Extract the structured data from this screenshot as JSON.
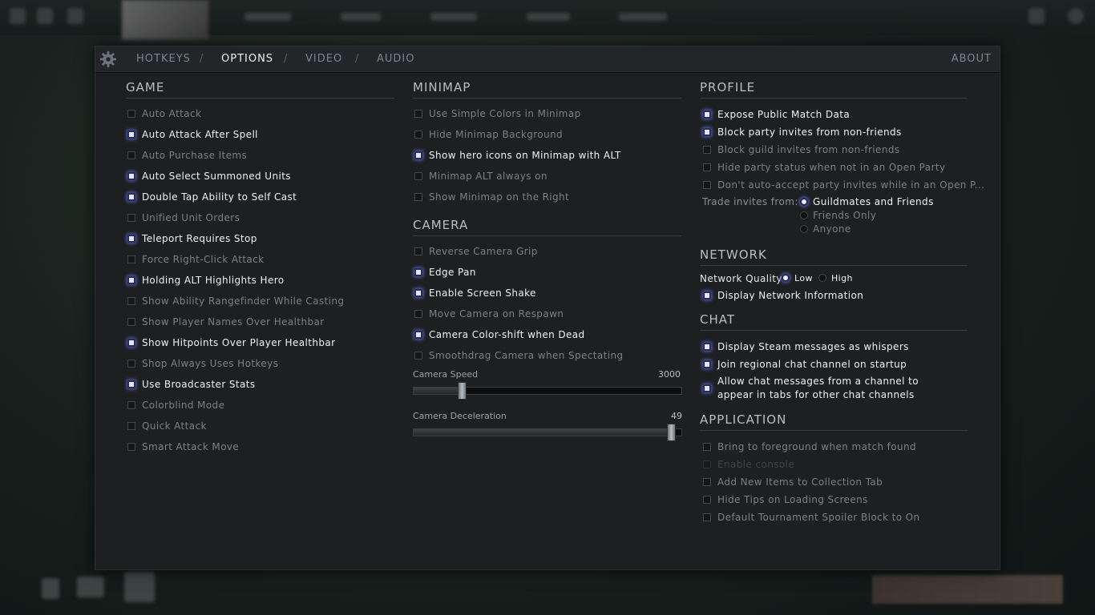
{
  "tabs": [
    "HOTKEYS",
    "OPTIONS",
    "VIDEO",
    "AUDIO"
  ],
  "tab_separator": "/",
  "about_label": "ABOUT",
  "game": {
    "title": "GAME",
    "options": [
      {
        "label": "Auto Attack",
        "checked": false
      },
      {
        "label": "Auto Attack After Spell",
        "checked": true
      },
      {
        "label": "Auto Purchase Items",
        "checked": false
      },
      {
        "label": "Auto Select Summoned Units",
        "checked": true
      },
      {
        "label": "Double Tap Ability to Self Cast",
        "checked": true
      },
      {
        "label": "Unified Unit Orders",
        "checked": false
      },
      {
        "label": "Teleport Requires Stop",
        "checked": true
      },
      {
        "label": "Force Right-Click Attack",
        "checked": false
      },
      {
        "label": "Holding ALT Highlights Hero",
        "checked": true
      },
      {
        "label": "Show Ability Rangefinder While Casting",
        "checked": false
      },
      {
        "label": "Show Player Names Over Healthbar",
        "checked": false
      },
      {
        "label": "Show Hitpoints Over Player Healthbar",
        "checked": true
      },
      {
        "label": "Shop Always Uses Hotkeys",
        "checked": false
      },
      {
        "label": "Use Broadcaster Stats",
        "checked": true
      },
      {
        "label": "Colorblind Mode",
        "checked": false
      },
      {
        "label": "Quick Attack",
        "checked": false
      },
      {
        "label": "Smart Attack Move",
        "checked": false
      }
    ]
  },
  "minimap": {
    "title": "MINIMAP",
    "options": [
      {
        "label": "Use Simple Colors in Minimap",
        "checked": false
      },
      {
        "label": "Hide Minimap Background",
        "checked": false
      },
      {
        "label": "Show hero icons on Minimap with ALT",
        "checked": true
      },
      {
        "label": "Minimap ALT always on",
        "checked": false
      },
      {
        "label": "Show Minimap on the Right",
        "checked": false
      }
    ]
  },
  "camera": {
    "title": "CAMERA",
    "options": [
      {
        "label": "Reverse Camera Grip",
        "checked": false
      },
      {
        "label": "Edge Pan",
        "checked": true
      },
      {
        "label": "Enable Screen Shake",
        "checked": true
      },
      {
        "label": "Move Camera on Respawn",
        "checked": false
      },
      {
        "label": "Camera Color-shift when Dead",
        "checked": true
      },
      {
        "label": "Smoothdrag Camera when Spectating",
        "checked": false
      }
    ],
    "speed_label": "Camera Speed",
    "speed_value": "3000",
    "speed_fraction": 0.18,
    "decel_label": "Camera Deceleration",
    "decel_value": "49",
    "decel_fraction": 0.96
  },
  "profile": {
    "title": "PROFILE",
    "options": [
      {
        "label": "Expose Public Match Data",
        "checked": true
      },
      {
        "label": "Block party invites from non-friends",
        "checked": true
      },
      {
        "label": "Block guild invites from non-friends",
        "checked": false
      },
      {
        "label": "Hide party status when not in an Open Party",
        "checked": false
      },
      {
        "label": "Don't auto-accept party invites while in an Open P...",
        "checked": false
      }
    ],
    "trade_label": "Trade invites from:",
    "trade_options": [
      {
        "label": "Guildmates and Friends",
        "selected": true
      },
      {
        "label": "Friends Only",
        "selected": false
      },
      {
        "label": "Anyone",
        "selected": false
      }
    ]
  },
  "network": {
    "title": "NETWORK",
    "quality_label": "Network Quality",
    "quality_options": [
      {
        "label": "Low",
        "selected": true
      },
      {
        "label": "High",
        "selected": false
      }
    ],
    "display_info": {
      "label": "Display Network Information",
      "checked": true
    }
  },
  "chat": {
    "title": "CHAT",
    "options": [
      {
        "label": "Display Steam messages as whispers",
        "checked": true
      },
      {
        "label": "Join regional chat channel on startup",
        "checked": true
      },
      {
        "label": "Allow chat messages from a channel to appear in tabs for other chat channels",
        "checked": true
      }
    ]
  },
  "application": {
    "title": "APPLICATION",
    "options": [
      {
        "label": "Bring to foreground when match found",
        "checked": false
      },
      {
        "label": "Enable console",
        "checked": false,
        "disabled": true
      },
      {
        "label": "Add New Items to Collection Tab",
        "checked": false
      },
      {
        "label": "Hide Tips on Loading Screens",
        "checked": false
      },
      {
        "label": "Default Tournament Spoiler Block to On",
        "checked": false
      }
    ]
  }
}
